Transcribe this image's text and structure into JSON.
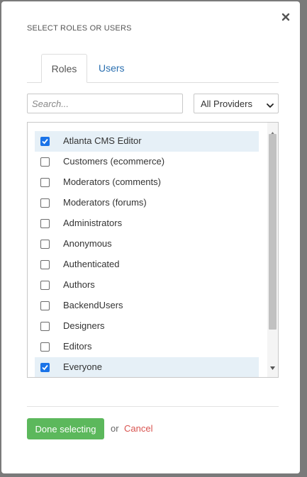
{
  "dialog": {
    "title": "SELECT ROLES OR USERS",
    "close_icon": "close-icon"
  },
  "tabs": [
    {
      "label": "Roles",
      "active": true
    },
    {
      "label": "Users",
      "active": false
    }
  ],
  "search": {
    "placeholder": "Search...",
    "value": ""
  },
  "provider_select": {
    "value": "All Providers",
    "icon": "chevron-down-icon"
  },
  "roles": [
    {
      "label": "Atlanta CMS Editor",
      "checked": true
    },
    {
      "label": "Customers (ecommerce)",
      "checked": false
    },
    {
      "label": "Moderators (comments)",
      "checked": false
    },
    {
      "label": "Moderators (forums)",
      "checked": false
    },
    {
      "label": "Administrators",
      "checked": false
    },
    {
      "label": "Anonymous",
      "checked": false
    },
    {
      "label": "Authenticated",
      "checked": false
    },
    {
      "label": "Authors",
      "checked": false
    },
    {
      "label": "BackendUsers",
      "checked": false
    },
    {
      "label": "Designers",
      "checked": false
    },
    {
      "label": "Editors",
      "checked": false
    },
    {
      "label": "Everyone",
      "checked": true
    }
  ],
  "footer": {
    "done_label": "Done selecting",
    "or_label": "or",
    "cancel_label": "Cancel"
  },
  "colors": {
    "accent_blue": "#1a73e8",
    "selected_row": "#e6f0f7",
    "done_green": "#5cb85c",
    "cancel_red": "#d9534f",
    "tab_link": "#2a6fb0"
  }
}
